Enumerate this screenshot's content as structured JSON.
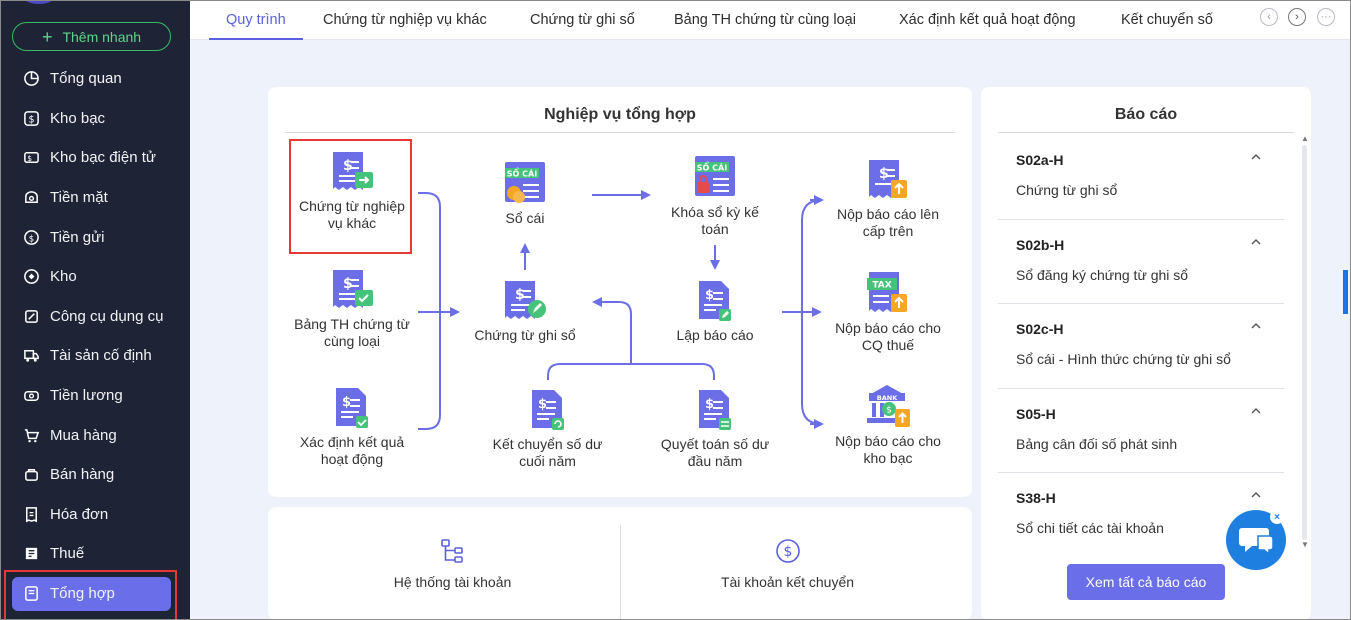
{
  "sidebar": {
    "quick_add": "Thêm nhanh",
    "items": [
      {
        "label": "Tổng quan",
        "icon": "pie-chart-icon"
      },
      {
        "label": "Kho bạc",
        "icon": "dollar-icon"
      },
      {
        "label": "Kho bạc điện tử",
        "icon": "card-icon"
      },
      {
        "label": "Tiền mặt",
        "icon": "cash-icon"
      },
      {
        "label": "Tiền gửi",
        "icon": "deposit-icon"
      },
      {
        "label": "Kho",
        "icon": "warehouse-icon"
      },
      {
        "label": "Công cụ dụng cụ",
        "icon": "tools-icon"
      },
      {
        "label": "Tài sản cố định",
        "icon": "truck-icon"
      },
      {
        "label": "Tiền lương",
        "icon": "salary-icon"
      },
      {
        "label": "Mua hàng",
        "icon": "cart-icon"
      },
      {
        "label": "Bán hàng",
        "icon": "bag-icon"
      },
      {
        "label": "Hóa đơn",
        "icon": "invoice-icon"
      },
      {
        "label": "Thuế",
        "icon": "tax-icon"
      },
      {
        "label": "Tổng hợp",
        "icon": "summary-icon"
      }
    ]
  },
  "tabs": [
    "Quy trình",
    "Chứng từ nghiệp vụ khác",
    "Chứng từ ghi sổ",
    "Bảng TH chứng từ cùng loại",
    "Xác định kết quả hoạt động",
    "Kết chuyển số"
  ],
  "process": {
    "title": "Nghiệp vụ tổng hợp",
    "nodes": {
      "other_vouchers": "Chứng từ nghiệp vụ khác",
      "same_type_summary": "Bảng TH chứng từ cùng loại",
      "determine_results": "Xác định kết quả hoạt động",
      "ledger": "Sổ cái",
      "ledger_badge": "SỔ CÁI",
      "recording_voucher": "Chứng từ ghi sổ",
      "carry_forward": "Kết chuyển số dư cuối năm",
      "lock_period": "Khóa sổ kỳ kế toán",
      "lock_badge": "SỔ CÁI",
      "make_report": "Lập báo cáo",
      "settle_opening": "Quyết toán số dư đầu năm",
      "submit_upper": "Nộp báo cáo lên cấp trên",
      "submit_tax": "Nộp báo cáo cho CQ thuế",
      "tax_badge": "TAX",
      "submit_treasury": "Nộp báo cáo cho kho bạc",
      "bank_badge": "BANK"
    }
  },
  "bottom": {
    "chart_of_accounts": "Hệ thống tài khoản",
    "carry_accounts": "Tài khoản kết chuyển"
  },
  "reports": {
    "title": "Báo cáo",
    "items": [
      {
        "code": "S02a-H",
        "name": "Chứng từ ghi sổ"
      },
      {
        "code": "S02b-H",
        "name": "Sổ đăng ký chứng từ ghi sổ"
      },
      {
        "code": "S02c-H",
        "name": "Sổ cái - Hình thức chứng từ ghi sổ"
      },
      {
        "code": "S05-H",
        "name": "Bảng cân đối số phát sinh"
      },
      {
        "code": "S38-H",
        "name": "Sổ chi tiết các tài khoản"
      }
    ],
    "see_all": "Xem tất cả báo cáo"
  },
  "colors": {
    "accent": "#6a6ee8",
    "sidebar_bg": "#1e2436",
    "highlight": "#e53935",
    "icon_purple": "#6b6ee6",
    "icon_green": "#46c37b",
    "icon_orange": "#f5a623"
  }
}
